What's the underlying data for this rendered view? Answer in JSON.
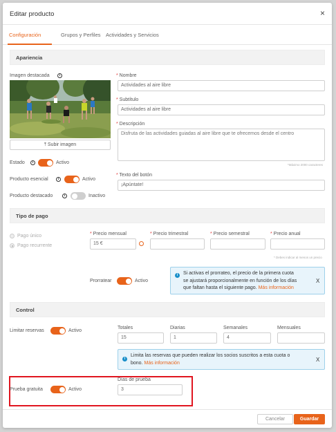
{
  "modal": {
    "title": "Editar producto",
    "close": "×"
  },
  "tabs": [
    {
      "label": "Configuración",
      "active": true
    },
    {
      "label": "Grupos y Perfiles",
      "active": false
    },
    {
      "label": "Actividades y Servicios",
      "active": false
    }
  ],
  "appearance": {
    "header": "Apariencia",
    "image_label": "Imagen destacada",
    "upload_label": "Subir imagen",
    "name_label": "Nombre",
    "name_value": "Actividades al aire libre",
    "subtitle_label": "Subtítulo",
    "subtitle_value": "Actividades al aire libre",
    "description_label": "Descripción",
    "description_value": "Disfruta de las actividades guiadas al aire libre que te ofrecemos desde el centro",
    "description_hint": "*Máximo 2000 caracteres",
    "button_text_label": "Texto del botón",
    "button_text_value": "¡Apúntate!",
    "estado_label": "Estado",
    "estado_value": "Activo",
    "esencial_label": "Producto esencial",
    "esencial_value": "Activo",
    "destacado_label": "Producto destacado",
    "destacado_value": "Inactivo"
  },
  "payment": {
    "header": "Tipo de pago",
    "single": "Pago único",
    "recurring": "Pago recurrente",
    "monthly_label": "Precio mensual",
    "monthly_value": "15 €",
    "quarterly_label": "Precio trimestral",
    "semester_label": "Precio semestral",
    "annual_label": "Precio anual",
    "price_hint": "* Debes indicar al menos un precio",
    "prorate_label": "Prorratear",
    "prorate_value": "Activo",
    "prorate_info_1": "Si activas el prorrateo, el precio de la primera cuota",
    "prorate_info_2": "se ajustará proporcionalmente en función de los días",
    "prorate_info_3": "que faltan hasta el siguiente pago.",
    "more_info": "Más información"
  },
  "control": {
    "header": "Control",
    "limit_label": "Limitar reservas",
    "limit_value": "Activo",
    "totals_label": "Totales",
    "totals_value": "15",
    "daily_label": "Diarias",
    "daily_value": "1",
    "weekly_label": "Semanales",
    "weekly_value": "4",
    "monthly_label": "Mensuales",
    "limit_info_1": "Limita las reservas que pueden realizar los socios suscritos a esta cuota o",
    "limit_info_2": "bono.",
    "more_info": "Más información",
    "trial_label": "Prueba gratuita",
    "trial_value": "Activo",
    "trial_days_label": "Días de prueba",
    "trial_days_value": "3"
  },
  "footer": {
    "cancel": "Cancelar",
    "save": "Guardar"
  },
  "colors": {
    "accent": "#e8631a",
    "info": "#1a8fc9",
    "highlight": "#e0141e"
  }
}
